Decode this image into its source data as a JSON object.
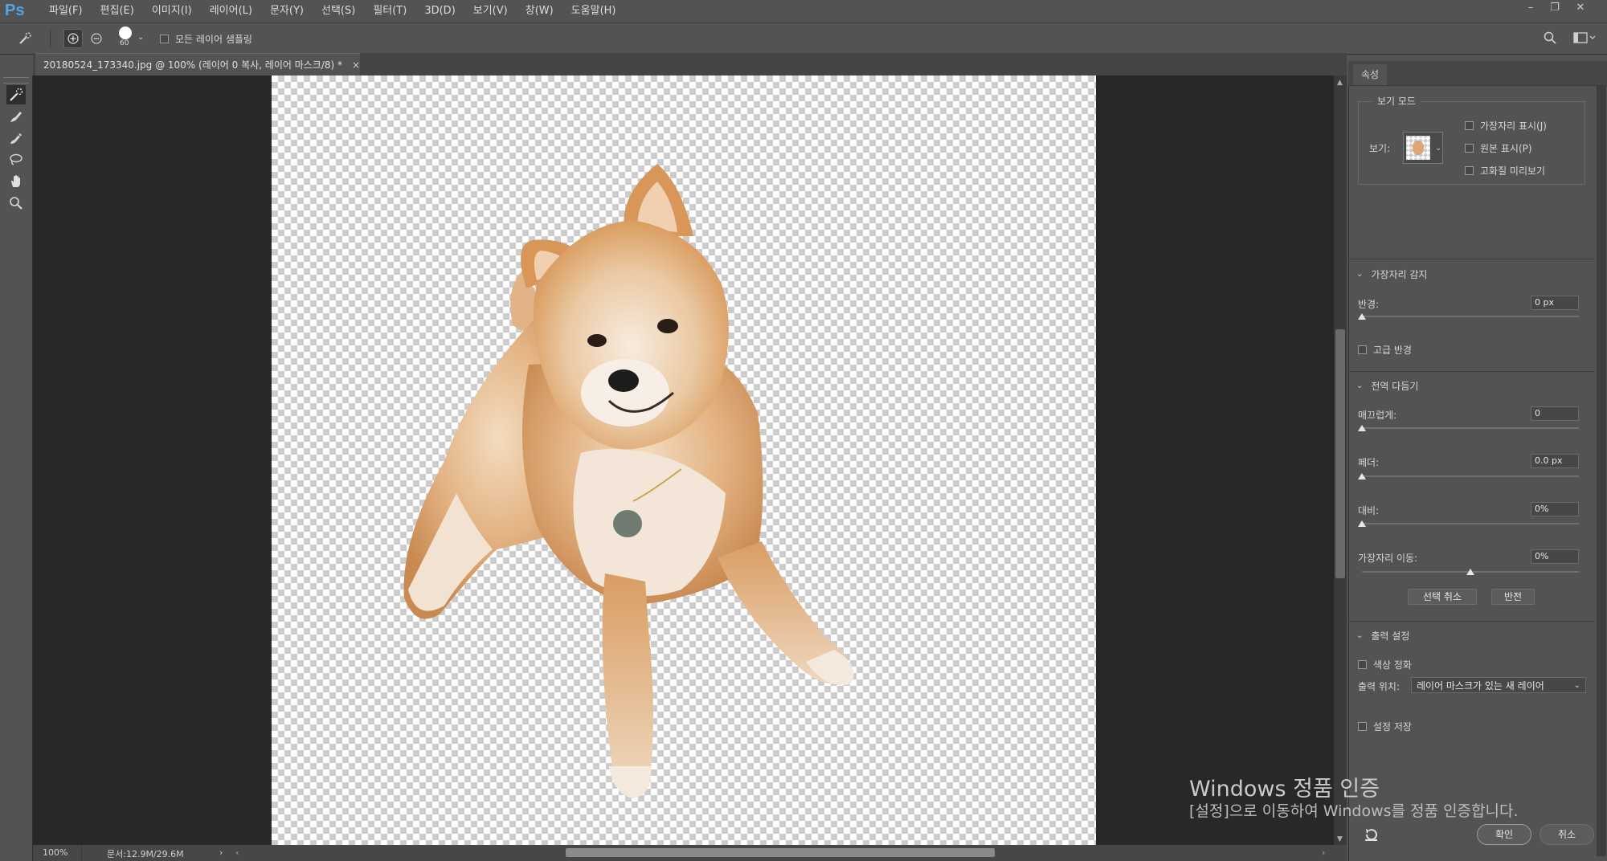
{
  "app": {
    "logo": "Ps"
  },
  "menu": [
    "파일(F)",
    "편집(E)",
    "이미지(I)",
    "레이어(L)",
    "문자(Y)",
    "선택(S)",
    "필터(T)",
    "3D(D)",
    "보기(V)",
    "창(W)",
    "도움말(H)"
  ],
  "window_controls": {
    "minimize": "–",
    "restore": "❐",
    "close": "✕"
  },
  "options": {
    "brush_size": "60",
    "sample_all_layers": "모든 레이어 샘플링",
    "sample_all_checked": false
  },
  "document": {
    "tab_title": "20180524_173340.jpg @ 100% (레이어 0 복사, 레이어 마스크/8) *",
    "close": "×"
  },
  "status": {
    "zoom": "100%",
    "doc_size": "문서:12.9M/29.6M"
  },
  "panel": {
    "tab": "속성",
    "view_mode": {
      "group_label": "보기 모드",
      "view_label": "보기:",
      "options": [
        {
          "label": "가장자리 표시(J)",
          "checked": false
        },
        {
          "label": "원본 표시(P)",
          "checked": false
        },
        {
          "label": "고화질 미리보기",
          "checked": false
        }
      ]
    },
    "edge_detection": {
      "title": "가장자리 감지",
      "radius_label": "반경:",
      "radius_value": "0 px",
      "radius_level": 0,
      "smart_radius": "고급 반경",
      "smart_radius_checked": false
    },
    "global_refine": {
      "title": "전역 다듬기",
      "smooth_label": "매끄럽게:",
      "smooth_value": "0",
      "smooth_level": 0,
      "feather_label": "페더:",
      "feather_value": "0.0 px",
      "feather_level": 0,
      "contrast_label": "대비:",
      "contrast_value": "0%",
      "contrast_level": 0,
      "shift_label": "가장자리 이동:",
      "shift_value": "0%",
      "shift_level": 0.5,
      "deselect": "선택 취소",
      "invert": "반전"
    },
    "output": {
      "title": "출력 설정",
      "decontaminate": "색상 정화",
      "decontaminate_checked": false,
      "output_to_label": "출력 위치:",
      "output_to_value": "레이어 마스크가 있는 새 레이어",
      "remember": "설정 저장",
      "remember_checked": false
    },
    "ok": "확인",
    "cancel": "취소"
  },
  "watermark": {
    "line1": "Windows 정품 인증",
    "line2": "[설정]으로 이동하여 Windows를 정품 인증합니다."
  },
  "colors": {
    "accent": "#4ea6e8",
    "bg": "#535353",
    "workspace": "#282828"
  }
}
